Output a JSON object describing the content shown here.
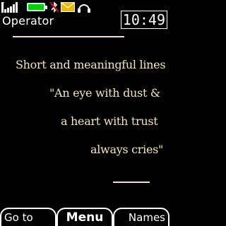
{
  "status": {
    "icons": [
      "signal-icon",
      "battery-icon",
      "bluetooth-off-icon",
      "message-icon",
      "headset-icon"
    ],
    "colors": {
      "battery": "#00d000",
      "message": "#f2b600",
      "bluetooth_off": "#e00000"
    }
  },
  "operator": "Operator",
  "clock": "10:49",
  "quote": {
    "line1": "Short and meaningful lines",
    "line2": "\"An eye with dust &",
    "line3": "a heart with trust",
    "line4": "always cries\"",
    "color": "#f7e3b3"
  },
  "softkeys": {
    "left": "Go to",
    "center": "Menu",
    "right": "Names"
  }
}
